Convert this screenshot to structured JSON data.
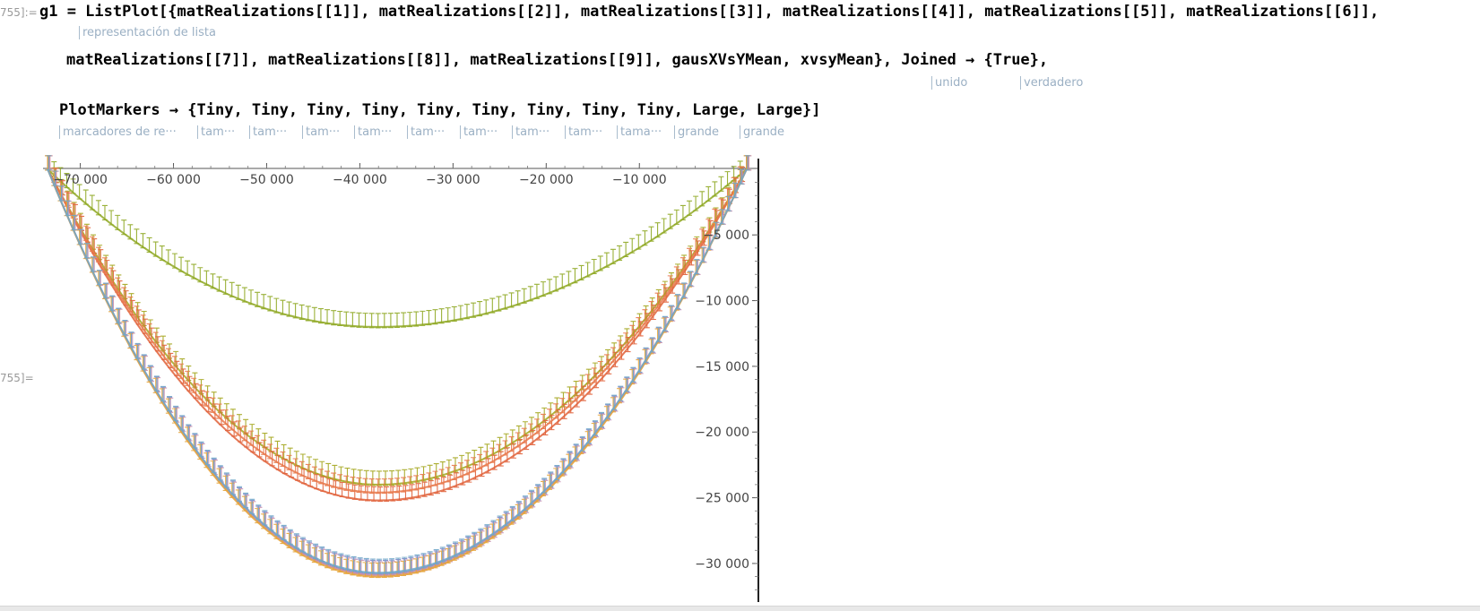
{
  "notebook": {
    "input_label": "755]:=",
    "output_label": "755]=",
    "code_lines": [
      "g1 = ListPlot[{matRealizations[[1]], matRealizations[[2]], matRealizations[[3]], matRealizations[[4]], matRealizations[[5]], matRealizations[[6]],",
      "matRealizations[[7]], matRealizations[[8]], matRealizations[[9]], gausXVsYMean, xvsyMean}, Joined → {True},",
      "PlotMarkers → {Tiny, Tiny, Tiny, Tiny, Tiny, Tiny, Tiny, Tiny, Tiny, Large, Large}]"
    ],
    "hints": {
      "listplot": "representación de lista",
      "joined": "unido",
      "true": "verdadero",
      "plotmarkers": "marcadores de re···",
      "tiny_short": "tam···",
      "tiny_9": "tama···",
      "large": "grande"
    }
  },
  "chart_data": {
    "type": "scatter",
    "title": "",
    "xlabel": "",
    "ylabel": "",
    "x_ticks": [
      "-70000",
      "-60000",
      "-50000",
      "-40000",
      "-30000",
      "-20000",
      "-10000"
    ],
    "y_ticks": [
      "-5000",
      "-10000",
      "-15000",
      "-20000",
      "-25000",
      "-30000"
    ],
    "x_range": [
      -74000,
      2000
    ],
    "y_range": [
      -32800,
      400
    ],
    "series": [
      {
        "color": "#8fa823",
        "depth": 12000,
        "vertex_x": -38000
      },
      {
        "color": "#a4a61e",
        "depth": 24000,
        "vertex_x": -38000
      },
      {
        "color": "#e0613a",
        "depth": 25200,
        "vertex_x": -38000
      },
      {
        "color": "#e8784a",
        "depth": 24600,
        "vertex_x": -38000
      },
      {
        "color": "#7f87c8",
        "depth": 30800,
        "vertex_x": -38000
      },
      {
        "color": "#c78fb0",
        "depth": 30900,
        "vertex_x": -38000
      },
      {
        "color": "#e6a43a",
        "depth": 31000,
        "vertex_x": -38000
      },
      {
        "color": "#6fa6c9",
        "depth": 30700,
        "vertex_x": -38000
      }
    ]
  }
}
